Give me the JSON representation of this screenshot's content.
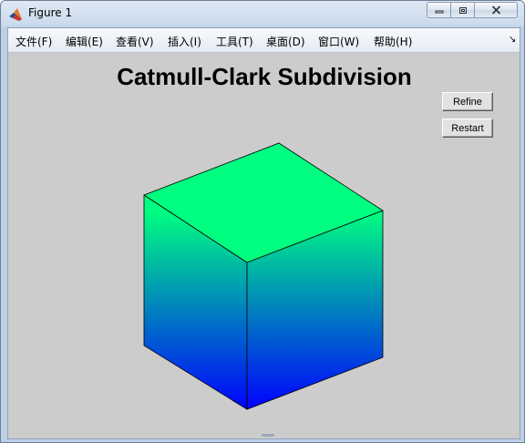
{
  "window": {
    "title": "Figure 1",
    "icons": {
      "app": "matlab-logo-icon",
      "minimize": "minimize-icon",
      "maximize": "restore-icon",
      "close": "close-icon"
    }
  },
  "menubar": {
    "items": [
      {
        "label": "文件(F)"
      },
      {
        "label": "编辑(E)"
      },
      {
        "label": "查看(V)"
      },
      {
        "label": "插入(I)"
      },
      {
        "label": "工具(T)"
      },
      {
        "label": "桌面(D)"
      },
      {
        "label": "窗口(W)"
      },
      {
        "label": "帮助(H)"
      }
    ],
    "overflow_icon": "dock-arrow-icon",
    "overflow_glyph": "↘"
  },
  "figure": {
    "title": "Catmull-Clark Subdivision",
    "background": "#cccccc",
    "cube_colors": {
      "top": "#00ff80",
      "bottom": "#0000ff",
      "edge": "#000000"
    }
  },
  "buttons": {
    "refine": "Refine",
    "restart": "Restart"
  }
}
